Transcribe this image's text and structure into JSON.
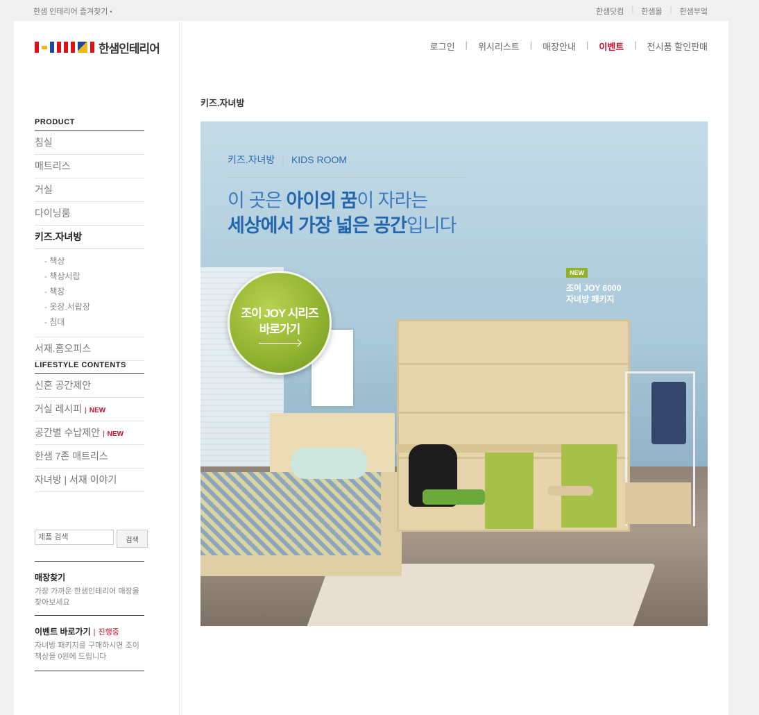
{
  "topbar": {
    "favorite": "한샘 인테리어 즐겨찾기",
    "family_links": [
      "한샘닷컴",
      "한샘몰",
      "한샘부엌"
    ]
  },
  "header": {
    "logo_text": "한샘인테리어",
    "gnb": [
      "로그인",
      "위시리스트",
      "매장안내",
      "이벤트",
      "전시품 할인판매"
    ],
    "active": "이벤트"
  },
  "sidebar": {
    "product_title": "PRODUCT",
    "items": [
      "침실",
      "매트리스",
      "거실",
      "다이닝룸",
      "키즈.자녀방"
    ],
    "active_item": "키즈.자녀방",
    "sub_items": [
      "책상",
      "책상서랍",
      "책장",
      "옷장.서랍장",
      "침대"
    ],
    "after_item": "서재.홈오피스",
    "lifestyle_title": "LIFESTYLE CONTENTS",
    "lifestyle_items": [
      {
        "label": "신혼 공간제안",
        "new": ""
      },
      {
        "label": "거실 레시피",
        "new": "NEW"
      },
      {
        "label": "공간별 수납제안",
        "new": "NEW"
      },
      {
        "label": "한샘 7존 매트리스",
        "new": ""
      },
      {
        "label": "자녀방 | 서재 이야기",
        "new": ""
      }
    ],
    "search_placeholder": "제품 검색",
    "search_button": "검색",
    "store": {
      "title": "매장찾기",
      "desc": "가장 가까운 한샘인테리어 매장을 찾아보세요"
    },
    "event": {
      "title": "이벤트 바로가기",
      "status": "진행중",
      "desc": "자녀방 패키지를 구매하시면 조이책상을 0원에 드립니다"
    }
  },
  "main": {
    "title": "키즈.자녀방",
    "banner": {
      "cat_ko": "키즈.자녀방",
      "cat_en": "KIDS ROOM",
      "head_line1_pre": "이 곳은 ",
      "head_line1_bold": "아이의 꿈",
      "head_line1_post": "이 자라는",
      "head_line2_bold": "세상에서 가장 넓은 공간",
      "head_line2_post": "입니다",
      "circle_line1": "조이 JOY 시리즈",
      "circle_line2": "바로가기",
      "new_badge": "NEW",
      "product_line1": "조이 JOY 6000",
      "product_line2": "자녀방 패키지"
    }
  },
  "colors": {
    "accent_red": "#c8102e",
    "banner_blue": "#2466ae",
    "circle_green": "#93b532"
  }
}
